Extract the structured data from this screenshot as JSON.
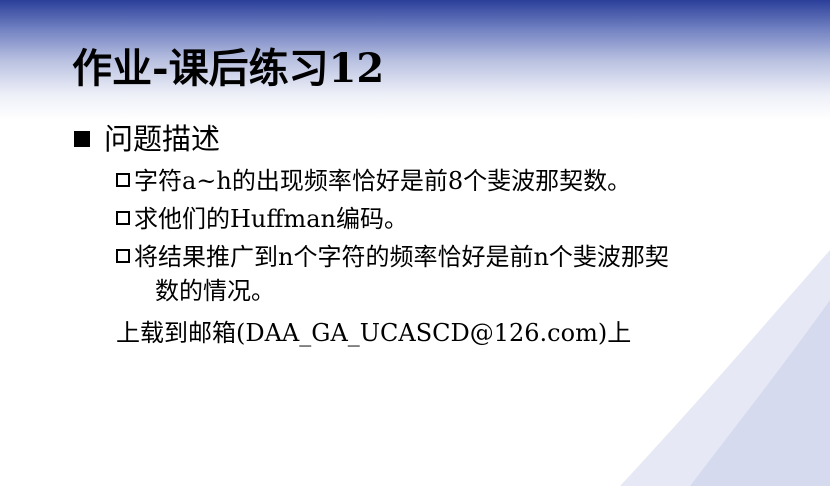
{
  "slide": {
    "title": "作业-课后练习12",
    "heading": "问题描述",
    "items": [
      "字符a~h的出现频率恰好是前8个斐波那契数。",
      "求他们的Huffman编码。",
      "将结果推广到n个字符的频率恰好是前n个斐波那契"
    ],
    "item3_continuation": "数的情况。",
    "note": "上载到邮箱(DAA_GA_UCASCD@126.com)上"
  },
  "colors": {
    "header_top": "#2b3f9a",
    "header_fade": "#b8c0e0",
    "swoosh": "#dfe3f2"
  }
}
